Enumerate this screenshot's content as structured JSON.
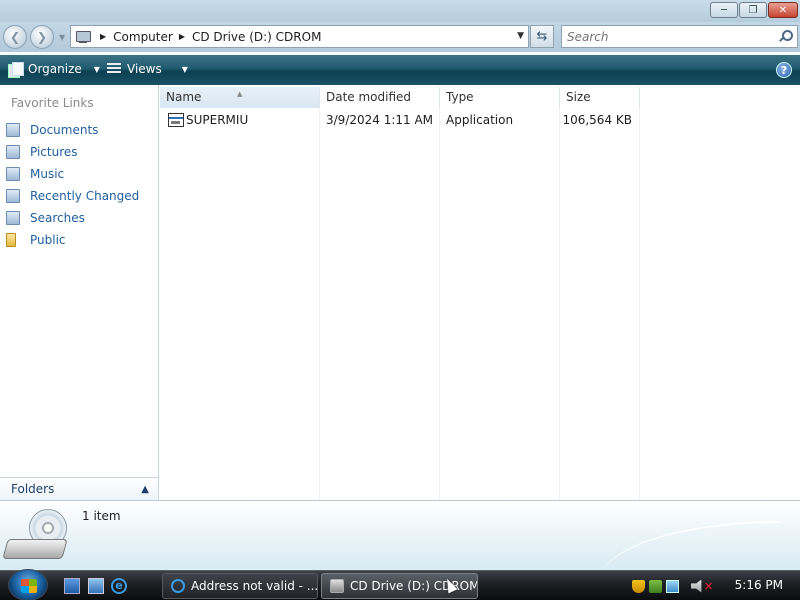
{
  "window": {
    "minimize_icon": "minimize-icon",
    "maximize_icon": "maximize-icon",
    "close_icon": "close-icon"
  },
  "address": {
    "crumbs": [
      "Computer",
      "CD Drive (D:) CDROM"
    ],
    "refresh_icon": "refresh-icon"
  },
  "search": {
    "placeholder": "Search",
    "value": ""
  },
  "toolbar": {
    "organize_label": "Organize",
    "views_label": "Views",
    "help_label": "?"
  },
  "nav": {
    "favorites_title": "Favorite Links",
    "items": [
      {
        "label": "Documents",
        "icon": "documents-icon"
      },
      {
        "label": "Pictures",
        "icon": "pictures-icon"
      },
      {
        "label": "Music",
        "icon": "music-icon"
      },
      {
        "label": "Recently Changed",
        "icon": "recently-changed-icon"
      },
      {
        "label": "Searches",
        "icon": "searches-icon"
      },
      {
        "label": "Public",
        "icon": "folder-icon"
      }
    ],
    "folders_label": "Folders"
  },
  "columns": {
    "name": "Name",
    "date": "Date modified",
    "type": "Type",
    "size": "Size"
  },
  "files": [
    {
      "name": "SUPERMIU",
      "date": "3/9/2024 1:11 AM",
      "type": "Application",
      "size": "106,564 KB"
    }
  ],
  "details": {
    "item_count": "1 item"
  },
  "taskbar": {
    "tasks": [
      {
        "label": "Address not valid - ...",
        "icon": "internet-explorer-icon"
      },
      {
        "label": "CD Drive (D:) CDROM",
        "icon": "cd-drive-icon"
      }
    ],
    "clock": "5:16 PM",
    "colors": {
      "accent": "#1f5a6f",
      "link": "#1f5e9f"
    }
  }
}
